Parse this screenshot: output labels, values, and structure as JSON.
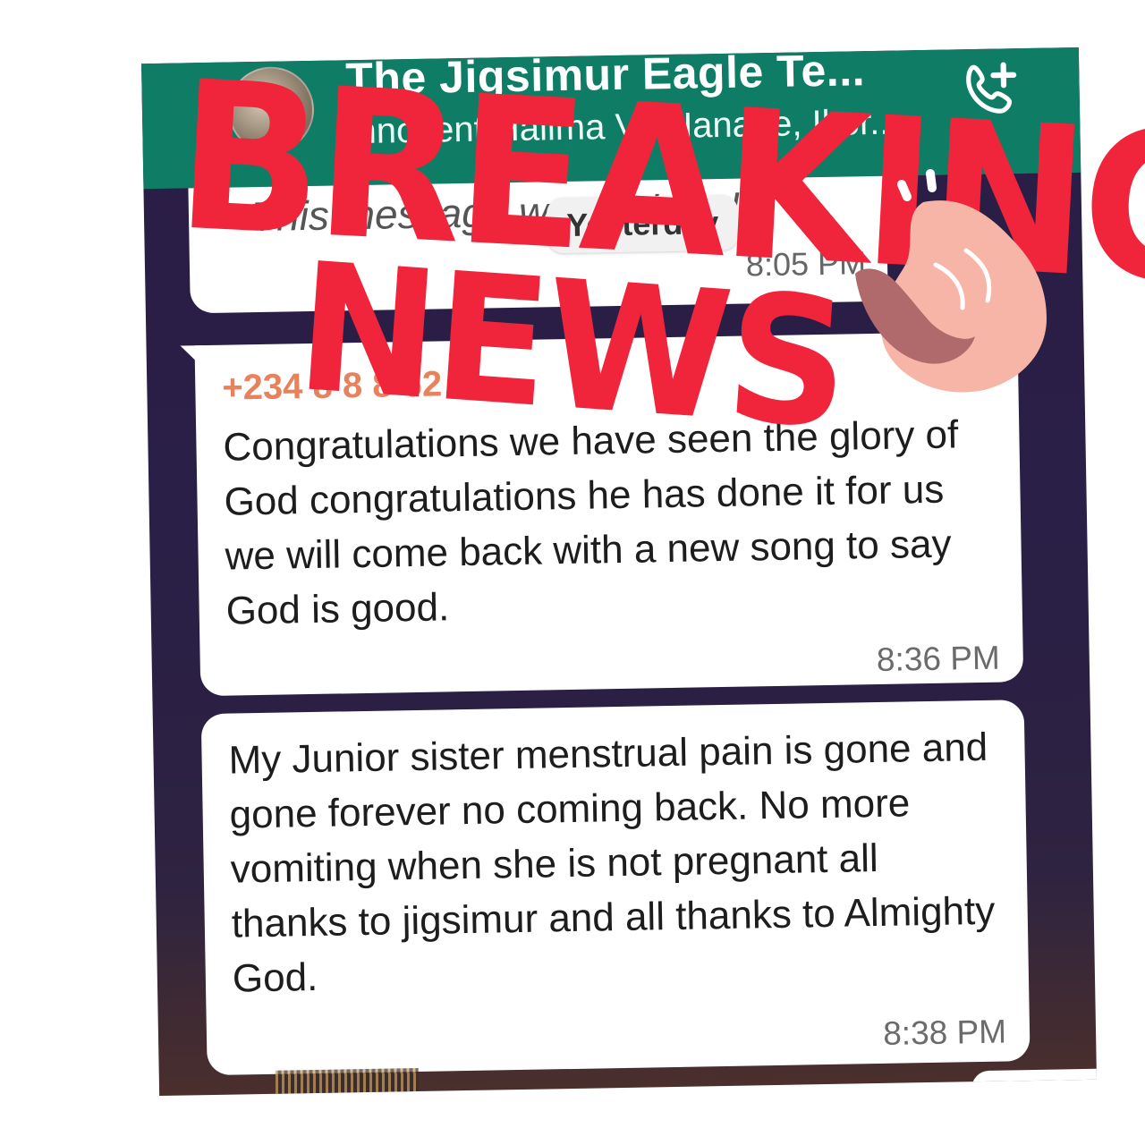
{
  "header": {
    "group_title": "The Jigsimur Eagle Te...",
    "group_subtitle": "Innocent Halima Ve Hanade, Ikor..."
  },
  "previous_message": {
    "text": "This message was deleted",
    "time": "8:05 PM"
  },
  "date_chip": "Yesterday",
  "messages": [
    {
      "sender": "+234 8 8 8 62 0",
      "text": "Congratulations we have seen the glory of God congratulations he has done it for us we will come back with a new song to say God is good.",
      "time": "8:36 PM"
    },
    {
      "text": "My Junior sister menstrual pain is gone and gone forever no coming back. No more vomiting when she is not pregnant all thanks to jigsimur and all thanks to Almighty God.",
      "time": "8:38 PM"
    }
  ],
  "overlay": {
    "line1": "BREAKING",
    "line2": "NEWS"
  },
  "icons": {
    "header_action": "add-call-icon",
    "sticker": "pointing-hand-icon"
  },
  "colors": {
    "header": "#0f7d66",
    "chat_background": "#2b1e47",
    "sender_name": "#e8825c",
    "overlay_text": "#f0243b"
  }
}
